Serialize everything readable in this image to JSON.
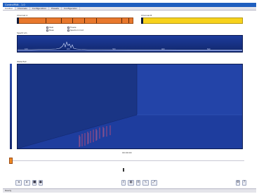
{
  "window": {
    "title": "ControlPAN - 1.0"
  },
  "tabs": [
    {
      "label": "Control"
    },
    {
      "label": "Channels"
    },
    {
      "label": "Configuration"
    },
    {
      "label": "Presets"
    },
    {
      "label": "Configurator"
    }
  ],
  "panels": {
    "channel_a": "Channel A",
    "channel_b": "Channel B",
    "spectrum": "Spectrum",
    "waterfall": "Waterfall"
  },
  "options": [
    {
      "label": "Peak"
    },
    {
      "label": "Mean"
    },
    {
      "label": "Freeze"
    },
    {
      "label": "Spectrum hold"
    }
  ],
  "spectrum_ticks": [
    "100",
    "200",
    "300",
    "400",
    "500"
  ],
  "time_label": "00:00:00",
  "status": {
    "text": "Ready"
  },
  "colors": {
    "channel_a_bar": "#e8782d",
    "channel_b_bar": "#f7d21c",
    "display_bg": "#1b3a95",
    "accent": "#1f5fbf"
  },
  "toolbar_icons": [
    "rewind-icon",
    "play-icon",
    "stop-icon",
    "record-icon",
    "zoom-icon",
    "grid-icon",
    "list-icon",
    "waveform-icon",
    "expand-icon",
    "settings-icon",
    "help-icon"
  ]
}
